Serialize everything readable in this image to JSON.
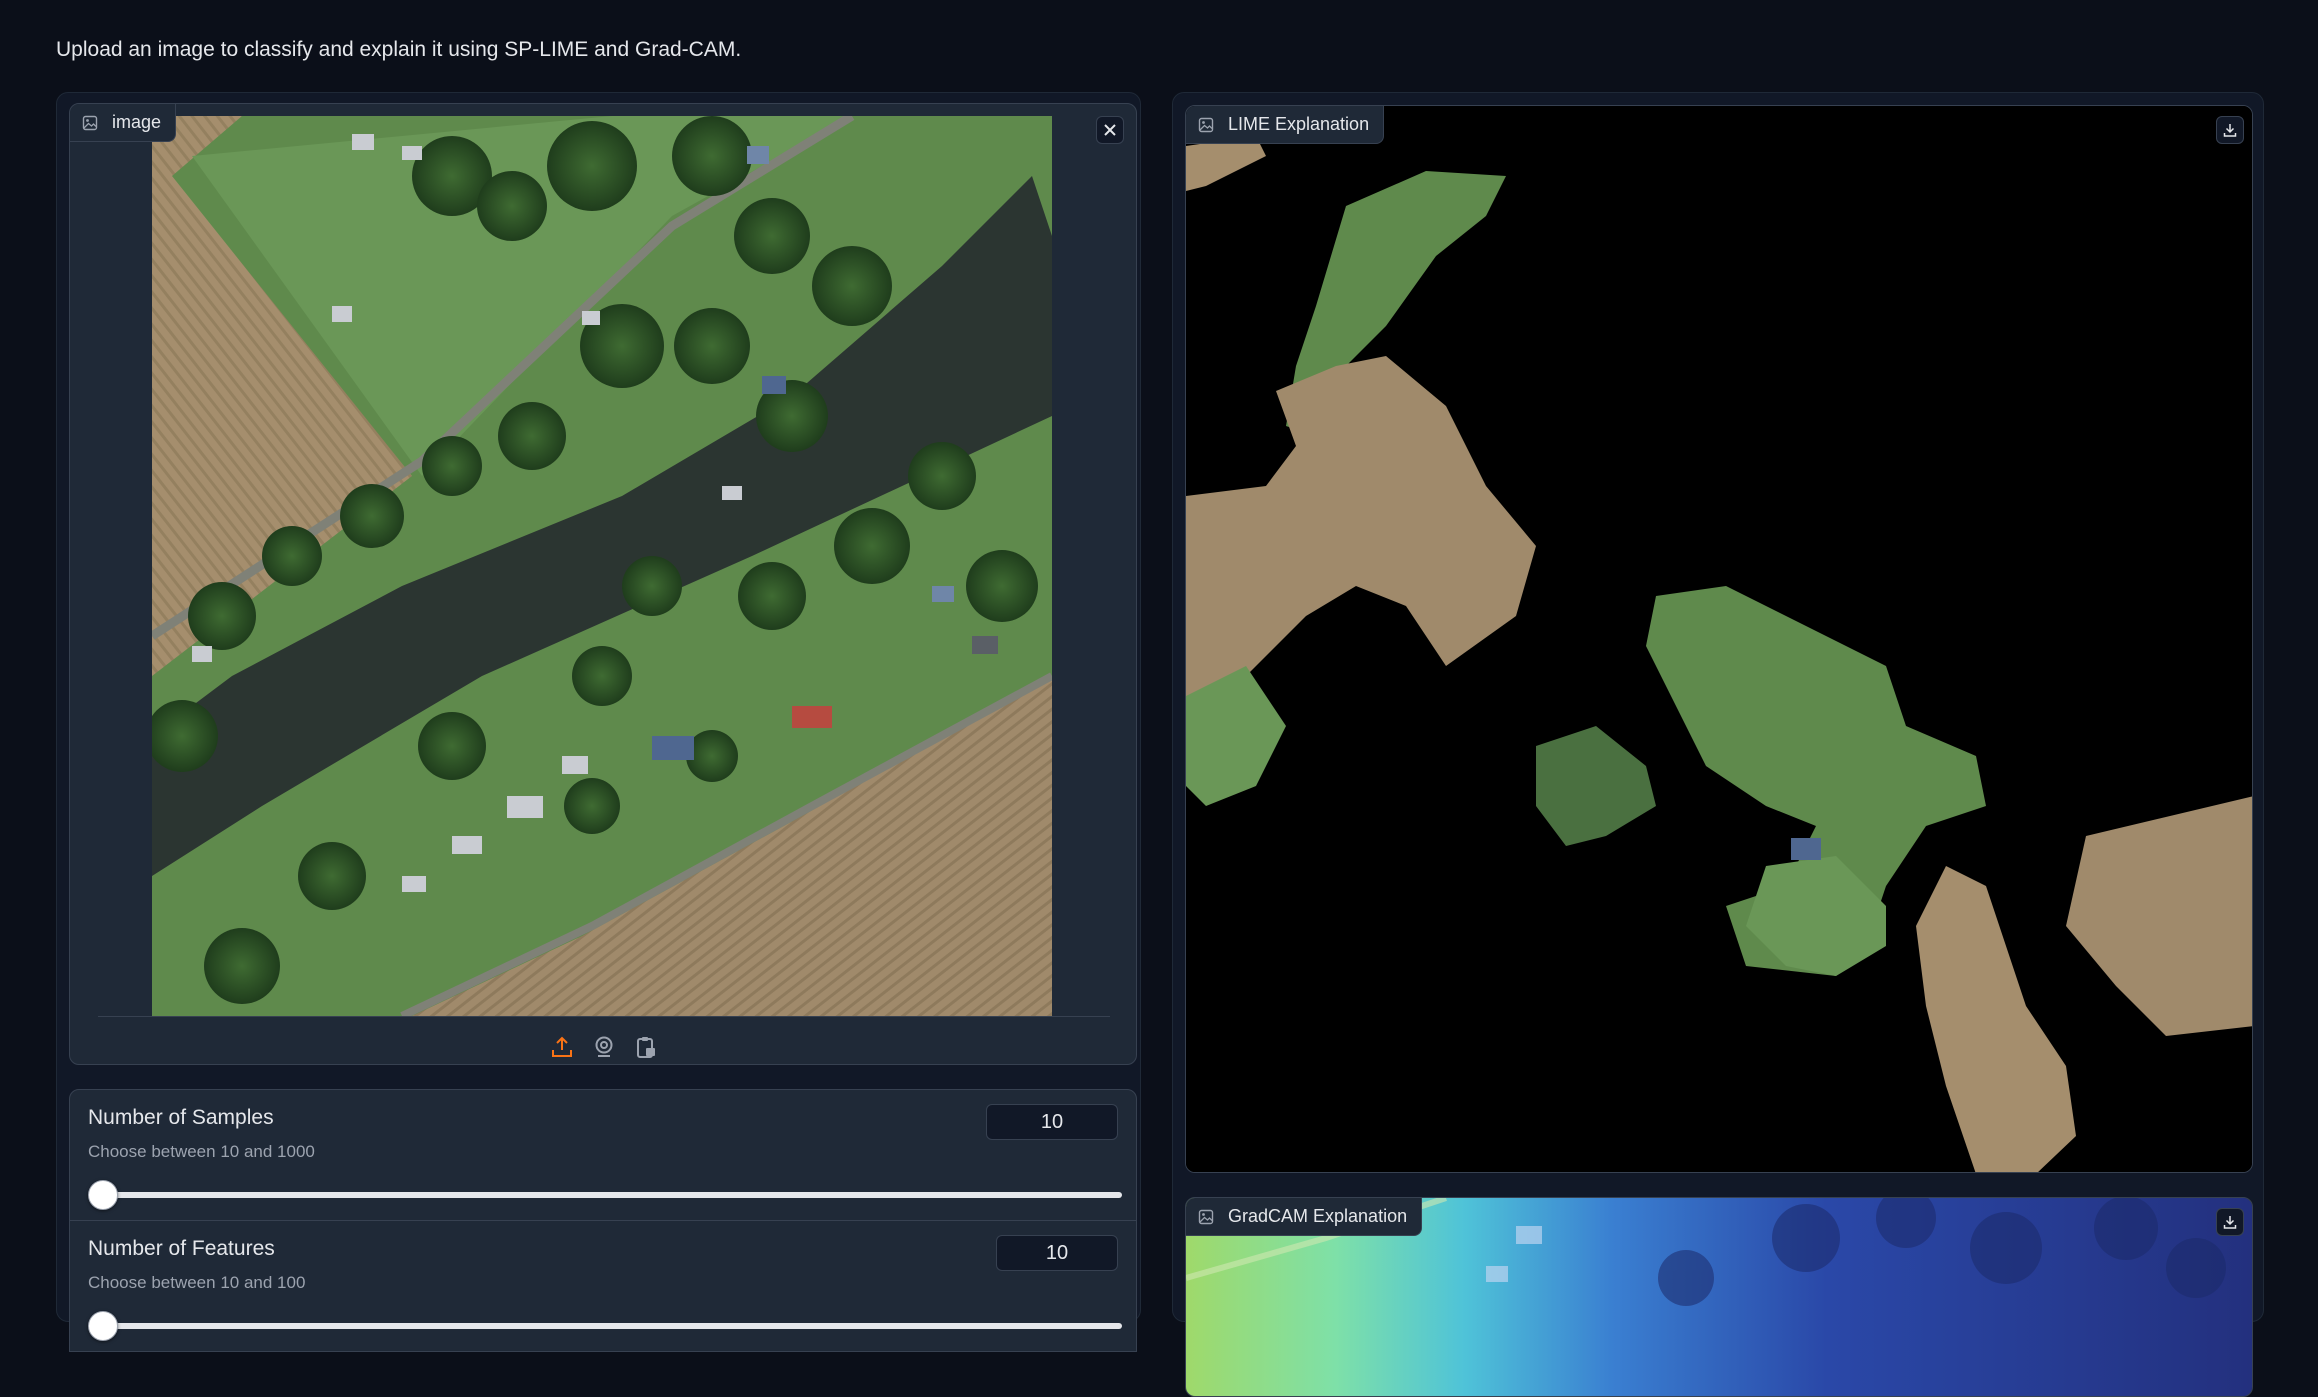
{
  "description": "Upload an image to classify and explain it using SP-LIME and Grad-CAM.",
  "input_panel": {
    "label": "image",
    "clear_icon": "close-icon",
    "toolbar": [
      "upload-icon",
      "webcam-icon",
      "clipboard-icon"
    ]
  },
  "controls": {
    "samples": {
      "title": "Number of Samples",
      "info": "Choose between 10 and 1000",
      "value": "10",
      "min": 10,
      "max": 1000
    },
    "features": {
      "title": "Number of Features",
      "info": "Choose between 10 and 100",
      "value": "10",
      "min": 10,
      "max": 100
    }
  },
  "outputs": {
    "lime": {
      "label": "LIME Explanation",
      "download_icon": "download-icon"
    },
    "gradcam": {
      "label": "GradCAM Explanation",
      "download_icon": "download-icon"
    }
  },
  "colors": {
    "background": "#0b0f19",
    "panel": "#1f2937",
    "border": "#374151",
    "accent": "#f97316"
  }
}
